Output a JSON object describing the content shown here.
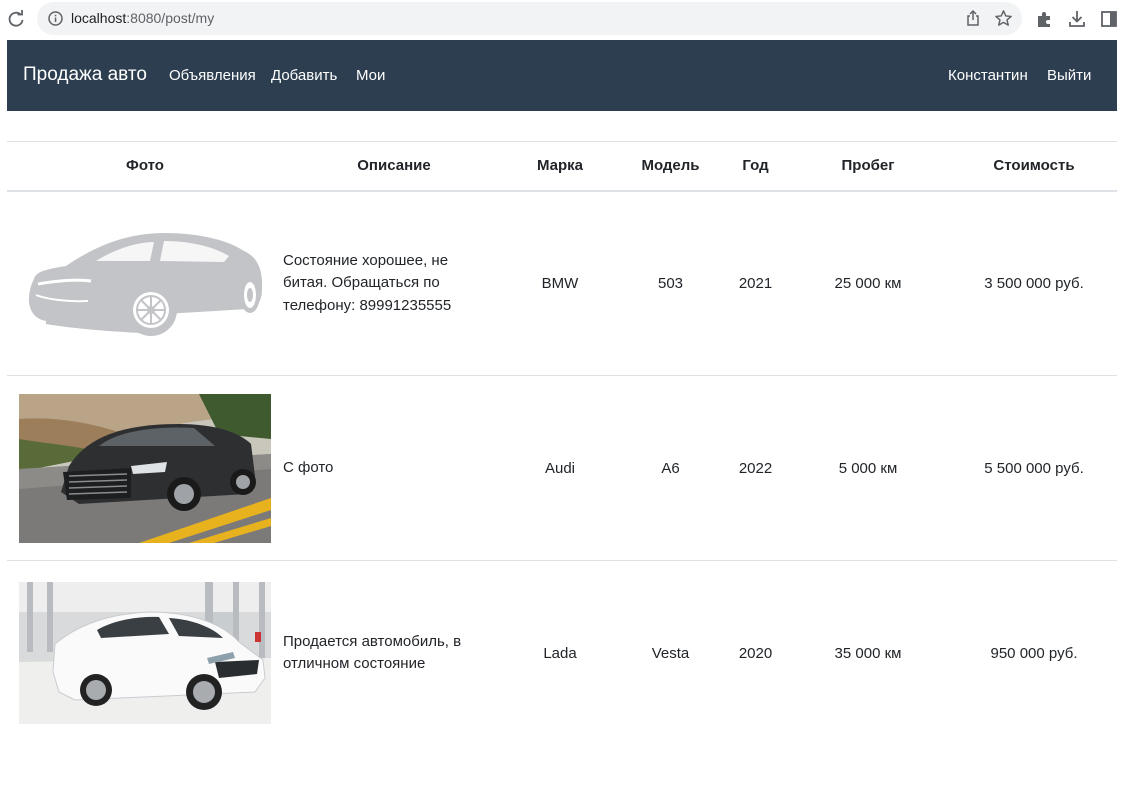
{
  "browser": {
    "url_host": "localhost",
    "url_path": ":8080/post/my"
  },
  "navbar": {
    "brand": "Продажа авто",
    "links": [
      "Объявления",
      "Добавить",
      "Мои"
    ],
    "user": "Константин",
    "logout": "Выйти",
    "background": "#2c3e50"
  },
  "table": {
    "headers": [
      "Фото",
      "Описание",
      "Марка",
      "Модель",
      "Год",
      "Пробег",
      "Стоимость"
    ],
    "rows": [
      {
        "photo": "car-placeholder-silhouette",
        "description": "Состояние хорошее, не битая. Обращаться по телефону: 89991235555",
        "brand": "BMW",
        "model": "503",
        "year": "2021",
        "mileage": "25 000 км",
        "price": "3 500 000 руб."
      },
      {
        "photo": "dark-sedan-on-road",
        "description": "С фото",
        "brand": "Audi",
        "model": "A6",
        "year": "2022",
        "mileage": "5 000 км",
        "price": "5 500 000 руб."
      },
      {
        "photo": "white-sedan-in-showroom",
        "description": "Продается автомобиль, в отличном состояние",
        "brand": "Lada",
        "model": "Vesta",
        "year": "2020",
        "mileage": "35 000 км",
        "price": "950 000 руб."
      }
    ]
  }
}
